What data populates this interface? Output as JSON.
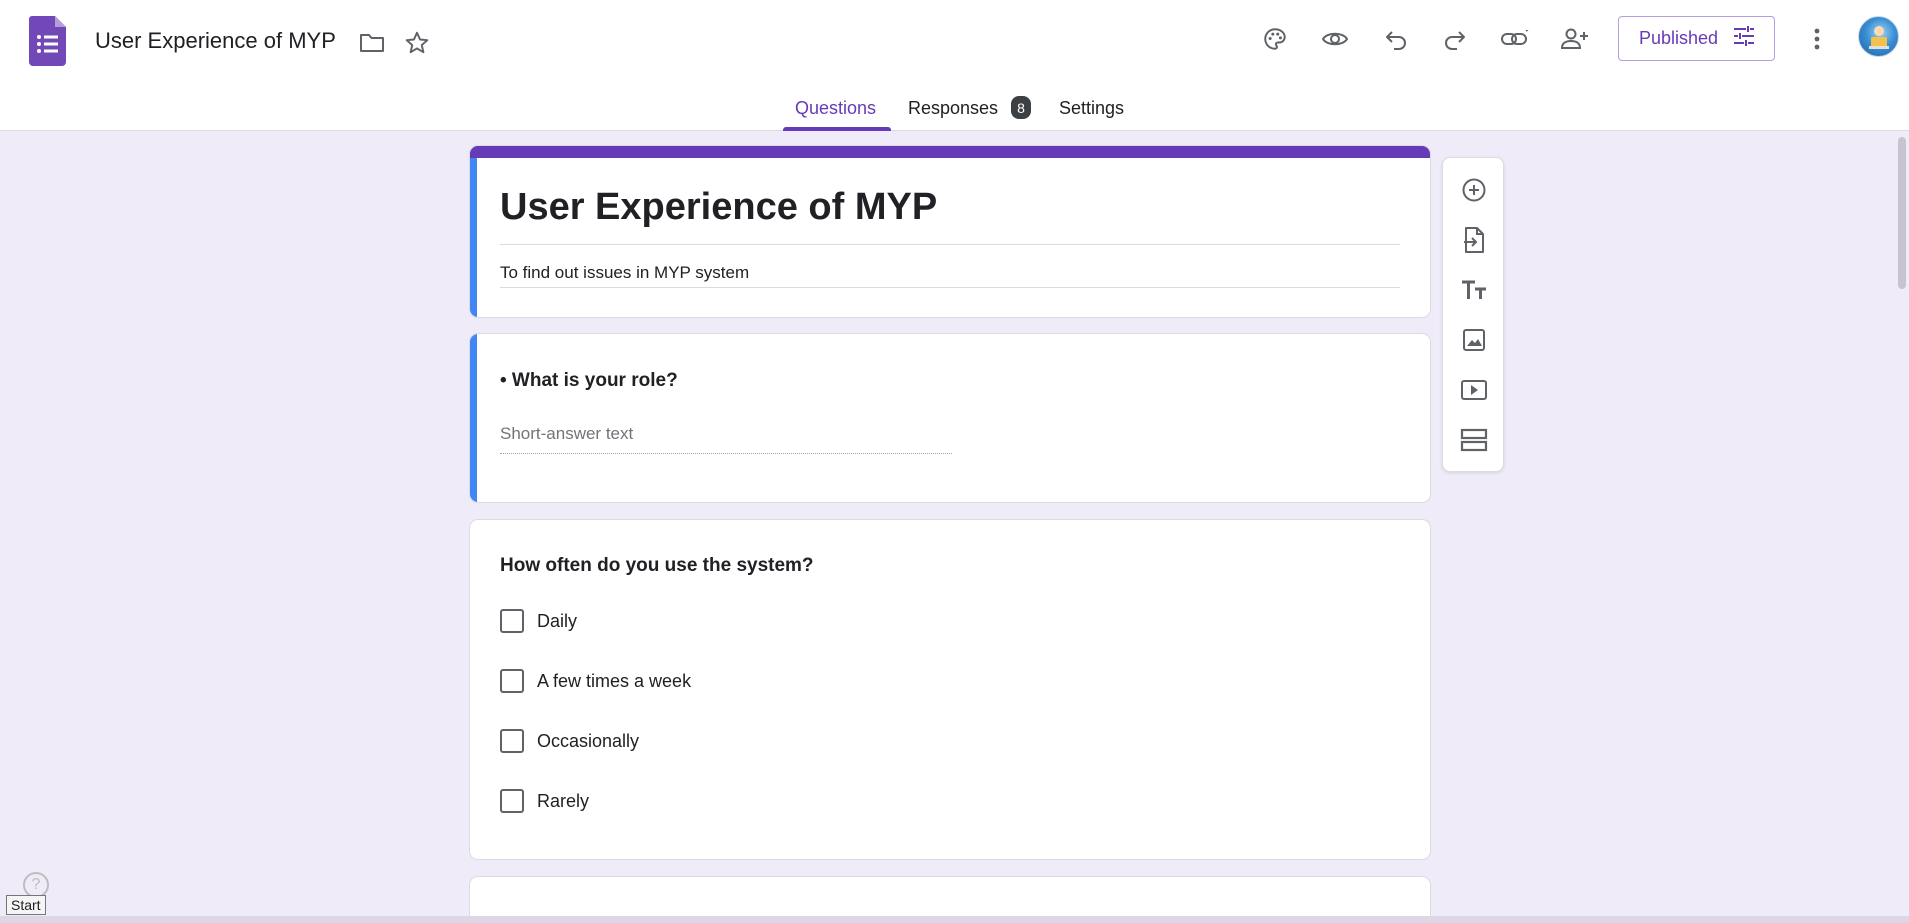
{
  "app": {
    "doc_title": "User Experience of MYP",
    "logo_icon": "google-forms-icon",
    "accent_color": "#673ab7",
    "background_color": "#f0ebf8",
    "selected_indicator_color": "#4285f4"
  },
  "header": {
    "icons": [
      "folder-icon",
      "star-icon",
      "palette-icon",
      "preview-eye-icon",
      "undo-icon",
      "redo-icon",
      "link-icon",
      "add-collaborator-icon",
      "more-vert-icon"
    ],
    "publish_label": "Published"
  },
  "tabs": {
    "questions": "Questions",
    "responses": "Responses",
    "responses_count": "8",
    "settings": "Settings",
    "active": "Questions"
  },
  "form": {
    "title": "User Experience of MYP",
    "description": "To find out issues in MYP system"
  },
  "questions": [
    {
      "title": "• What is your role?",
      "type": "short-answer",
      "placeholder": "Short-answer text"
    },
    {
      "title": "How often do you use the system?",
      "type": "checkboxes",
      "options": [
        "Daily",
        "A few times a week",
        "Occasionally",
        "Rarely"
      ]
    }
  ],
  "toolbar": {
    "tools": [
      "add-question-icon",
      "import-questions-icon",
      "add-title-icon",
      "add-image-icon",
      "add-video-icon",
      "add-section-icon"
    ]
  },
  "misc": {
    "tooltip": "Start",
    "help_symbol": "?"
  }
}
